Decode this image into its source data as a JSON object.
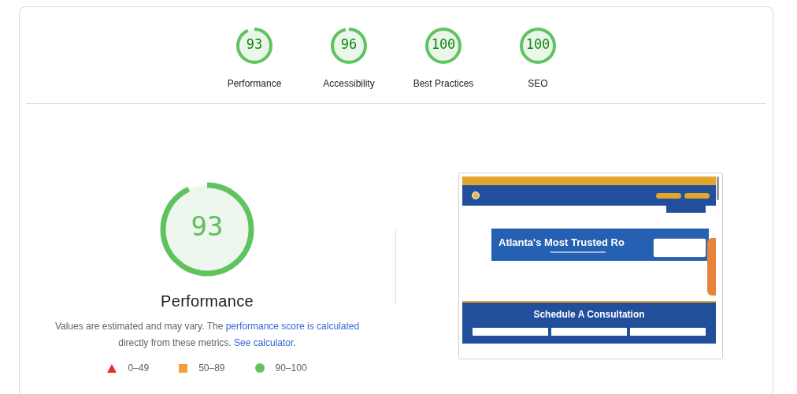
{
  "summary_gauges": [
    {
      "score": "93",
      "label": "Performance",
      "level": 0.93
    },
    {
      "score": "96",
      "label": "Accessibility",
      "level": 0.96
    },
    {
      "score": "100",
      "label": "Best Practices",
      "level": 1
    },
    {
      "score": "100",
      "label": "SEO",
      "level": 1
    }
  ],
  "main_gauge": {
    "score": "93",
    "level": 0.93,
    "title": "Performance"
  },
  "description": {
    "text": "Values are estimated and may vary. The ",
    "link_1": "performance score is calculated",
    "middle": " directly from these metrics. ",
    "link_2": "See calculator."
  },
  "legend": [
    {
      "kind": "triangle",
      "color": "#e03131",
      "range": "0–49"
    },
    {
      "kind": "square",
      "color": "#f0a038",
      "range": "50–89"
    },
    {
      "kind": "circle",
      "color": "#5fc35f",
      "range": "90–100"
    }
  ],
  "preview": {
    "hero_title": "Atlanta's Most Trusted Ro",
    "section_title": "Schedule A Consultation"
  }
}
